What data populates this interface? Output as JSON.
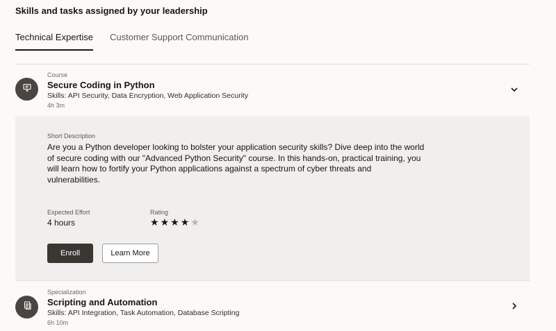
{
  "section": {
    "title": "Skills and tasks assigned by your leadership"
  },
  "tabs": [
    {
      "label": "Technical Expertise",
      "active": true
    },
    {
      "label": "Customer Support Communication",
      "active": false
    }
  ],
  "items": [
    {
      "type": "Course",
      "title": "Secure Coding in Python",
      "skills": "Skills: API Security, Data Encryption, Web Application Security",
      "duration": "4h 3m",
      "icon": "presentation-board-icon",
      "expanded": true,
      "details": {
        "description_label": "Short Description",
        "description": "Are you a Python developer looking to bolster your application security skills? Dive deep into the world of secure coding with our \"Advanced Python Security\" course. In this hands-on, practical training, you will learn how to fortify your Python applications against a spectrum of cyber threats and vulnerabilities.",
        "effort_label": "Expected Effort",
        "effort_value": "4 hours",
        "rating_label": "Rating",
        "rating": 4,
        "rating_max": 5,
        "enroll_label": "Enroll",
        "learn_more_label": "Learn More"
      }
    },
    {
      "type": "Specialization",
      "title": "Scripting and Automation",
      "skills": "Skills:  API Integration, Task Automation, Database Scripting",
      "duration": "6h 10m",
      "icon": "document-stack-icon",
      "expanded": false
    }
  ],
  "colors": {
    "background": "#fbfaf8",
    "panel": "#f1efed",
    "primary_button": "#3a3632",
    "avatar": "#4b4541"
  }
}
